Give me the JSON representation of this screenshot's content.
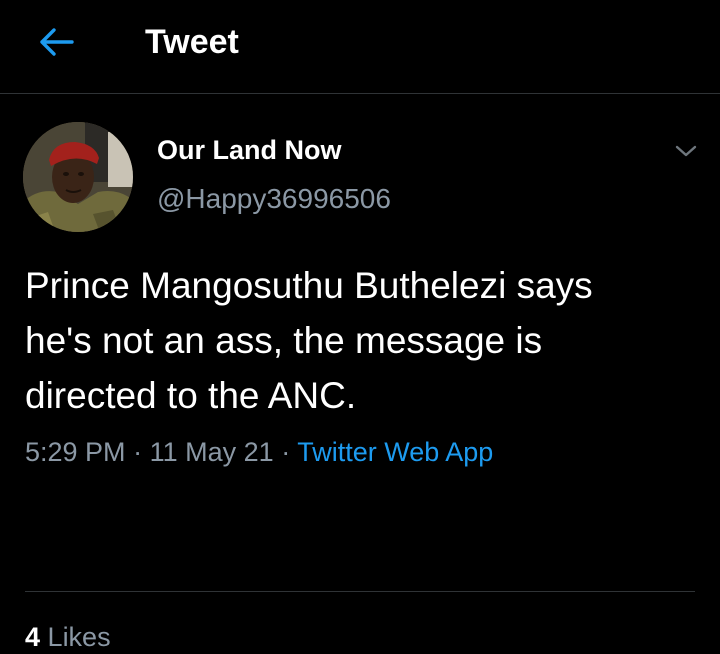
{
  "header": {
    "title": "Tweet",
    "back_icon": "arrow-left-icon",
    "accent_color": "#1d9bf0"
  },
  "tweet": {
    "author": {
      "name": "Our Land Now",
      "handle": "@Happy36996506",
      "avatar": "avatar-photo"
    },
    "text": "Prince Mangosuthu Buthelezi says\nhe's not an ass, the message is\ndirected to the ANC.",
    "time": "5:29 PM",
    "separator": "·",
    "date": "11 May 21",
    "source": "Twitter Web App",
    "menu_icon": "chevron-down-icon",
    "likes": {
      "count": "4",
      "label": "Likes"
    }
  },
  "colors": {
    "background": "#000000",
    "text_primary": "#ffffff",
    "text_secondary": "#8b98a5",
    "link": "#1d9bf0",
    "divider": "#2f3336"
  }
}
